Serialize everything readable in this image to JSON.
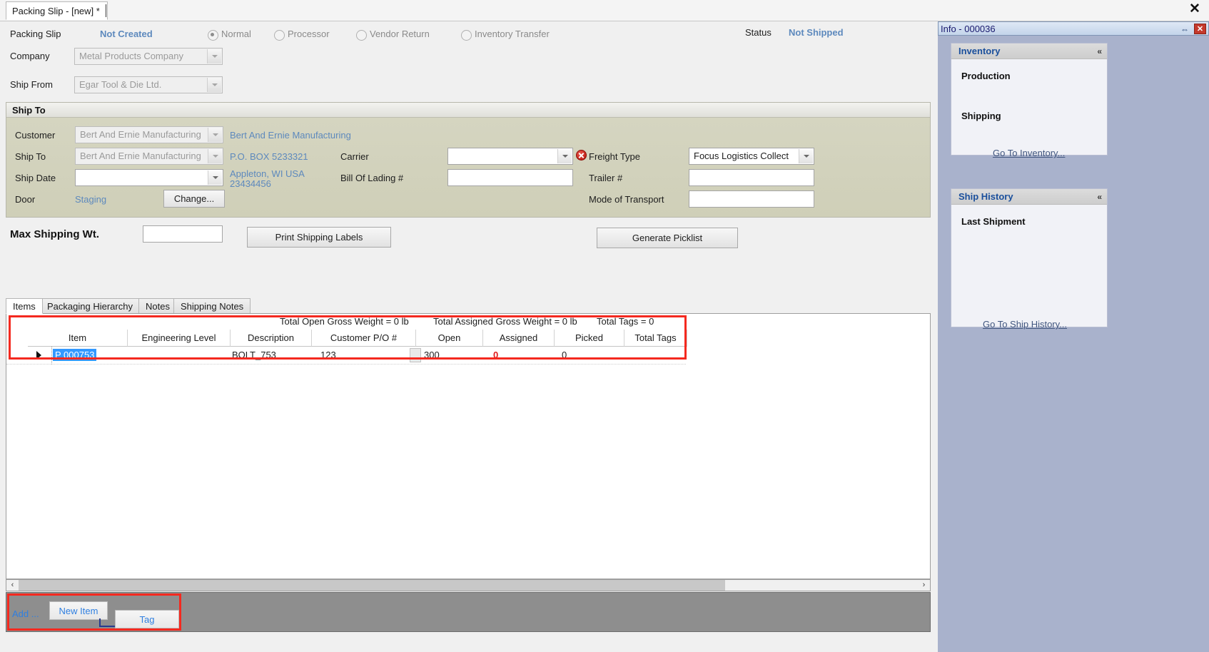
{
  "window": {
    "tab_title": "Packing Slip - [new] *",
    "close_icon": "close-icon",
    "close_glyph": "✕"
  },
  "header": {
    "packing_slip_label": "Packing Slip",
    "packing_slip_value": "Not Created",
    "status_label": "Status",
    "status_value": "Not Shipped",
    "types": [
      {
        "label": "Normal",
        "selected": true
      },
      {
        "label": "Processor",
        "selected": false
      },
      {
        "label": "Vendor Return",
        "selected": false
      },
      {
        "label": "Inventory Transfer",
        "selected": false
      }
    ],
    "company_label": "Company",
    "company_value": "Metal Products Company",
    "ship_from_label": "Ship From",
    "ship_from_value": "Egar Tool & Die Ltd."
  },
  "ship_to": {
    "group_title": "Ship To",
    "customer_label": "Customer",
    "customer_value": "Bert And Ernie Manufacturing",
    "customer_display": "Bert And Ernie Manufacturing",
    "ship_to_label": "Ship To",
    "ship_to_value": "Bert And Ernie Manufacturing",
    "address_line1": "P.O. BOX 5233321",
    "address_line2": "Appleton, WI USA",
    "address_line3": "23434456",
    "ship_date_label": "Ship Date",
    "ship_date_value": "",
    "door_label": "Door",
    "door_value": "Staging",
    "change_button": "Change...",
    "carrier_label": "Carrier",
    "carrier_value": "",
    "bill_of_lading_label": "Bill Of Lading #",
    "bill_of_lading_value": "",
    "freight_type_label": "Freight Type",
    "freight_type_value": "Focus Logistics Collect",
    "freight_type_error_icon": "error-icon",
    "trailer_label": "Trailer #",
    "trailer_value": "",
    "mode_of_transport_label": "Mode of Transport",
    "mode_of_transport_value": ""
  },
  "toolbar": {
    "max_shipping_wt_label": "Max Shipping Wt.",
    "max_shipping_wt_value": "",
    "print_shipping_labels": "Print Shipping Labels",
    "generate_picklist": "Generate Picklist"
  },
  "tabs": [
    {
      "label": "Items",
      "selected": true
    },
    {
      "label": "Packaging Hierarchy",
      "selected": false
    },
    {
      "label": "Notes",
      "selected": false
    },
    {
      "label": "Shipping Notes",
      "selected": false
    }
  ],
  "grid": {
    "totals": {
      "open_gross_weight": "Total Open Gross Weight = 0 lb",
      "assigned_gross_weight": "Total Assigned Gross Weight = 0 lb",
      "total_tags": "Total Tags = 0"
    },
    "columns": [
      "Item",
      "Engineering Level",
      "Description",
      "Customer P/O #",
      "Open",
      "Assigned",
      "Picked",
      "Total Tags"
    ],
    "rows": [
      {
        "item": "P 000753",
        "engineering_level": "",
        "description": "BOLT_753",
        "customer_po": "123",
        "open": "300",
        "assigned": "0",
        "picked": "0",
        "total_tags": ""
      }
    ]
  },
  "scrollbar": {
    "left_arrow": "‹",
    "right_arrow": "›"
  },
  "action_bar": {
    "add_label": "Add ...",
    "new_item_label": "New Item",
    "tag_label": "Tag"
  },
  "dock": {
    "title": "Info - 000036",
    "pin_glyph": "⇔",
    "close_glyph": "✕",
    "panels": [
      {
        "header": "Inventory",
        "chevron": "«",
        "sub_items": [
          "Production",
          "Shipping"
        ],
        "link": "Go To Inventory..."
      },
      {
        "header": "Ship History",
        "chevron": "«",
        "sub_items": [
          "Last Shipment"
        ],
        "link": "Go To Ship History..."
      }
    ]
  },
  "colors": {
    "accent_blue": "#5d89bd",
    "link_blue": "#2f7fe0",
    "highlight_red": "#f4291f",
    "selection_blue": "#3399ff",
    "error_red": "#b5120a",
    "shipto_bg": "#d6d6c2",
    "dock_bg": "#a9b2cc"
  }
}
